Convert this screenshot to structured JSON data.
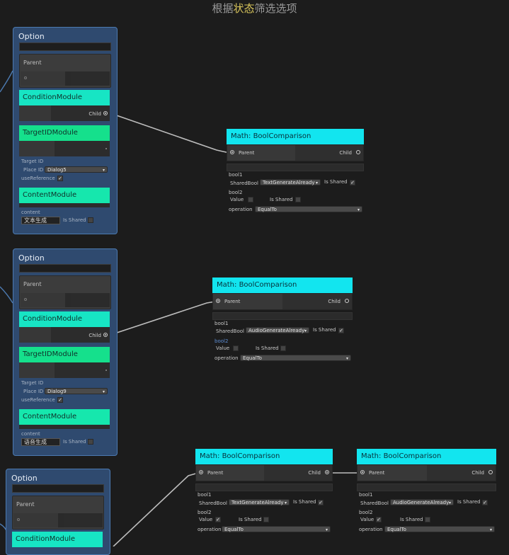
{
  "header": {
    "title_prefix": "根据",
    "title_highlight": "状态",
    "title_suffix": "筛选选项"
  },
  "options": [
    {
      "title": "Option",
      "parent_label": "Parent",
      "condition_label": "ConditionModule",
      "child_label": "Child",
      "target_label": "TargetIDModule",
      "target_id_label": "Target ID",
      "place_id_label": "Place ID",
      "place_id_value": "Dialog5",
      "use_reference_label": "useReference",
      "content_label": "ContentModule",
      "content_field_label": "content",
      "content_value": "文本生成",
      "is_shared_label": "Is Shared"
    },
    {
      "title": "Option",
      "parent_label": "Parent",
      "condition_label": "ConditionModule",
      "child_label": "Child",
      "target_label": "TargetIDModule",
      "target_id_label": "Target ID",
      "place_id_label": "Place ID",
      "place_id_value": "Dialog9",
      "use_reference_label": "useReference",
      "content_label": "ContentModule",
      "content_field_label": "content",
      "content_value": "语音生成",
      "is_shared_label": "Is Shared"
    },
    {
      "title": "Option",
      "parent_label": "Parent",
      "condition_label": "ConditionModule"
    }
  ],
  "bool_nodes": [
    {
      "title": "Math: BoolComparison",
      "parent_label": "Parent",
      "child_label": "Child",
      "bool1_label": "bool1",
      "shared_bool_label": "SharedBool",
      "shared_bool_value": "TextGenerateAlready",
      "is_shared_label": "Is Shared",
      "bool2_label": "bool2",
      "value_label": "Value",
      "operation_label": "operation",
      "operation_value": "EqualTo"
    },
    {
      "title": "Math: BoolComparison",
      "parent_label": "Parent",
      "child_label": "Child",
      "bool1_label": "bool1",
      "shared_bool_label": "SharedBool",
      "shared_bool_value": "AudioGenerateAlready",
      "is_shared_label": "Is Shared",
      "bool2_label": "bool2",
      "value_label": "Value",
      "operation_label": "operation",
      "operation_value": "EqualTo"
    },
    {
      "title": "Math: BoolComparison",
      "parent_label": "Parent",
      "child_label": "Child",
      "bool1_label": "bool1",
      "shared_bool_label": "SharedBool",
      "shared_bool_value": "TextGenerateAlready",
      "is_shared_label": "Is Shared",
      "bool2_label": "bool2",
      "value_label": "Value",
      "operation_label": "operation",
      "operation_value": "EqualTo"
    },
    {
      "title": "Math: BoolComparison",
      "parent_label": "Parent",
      "child_label": "Child",
      "bool1_label": "bool1",
      "shared_bool_label": "SharedBool",
      "shared_bool_value": "AudioGenerateAlready",
      "is_shared_label": "Is Shared",
      "bool2_label": "bool2",
      "value_label": "Value",
      "operation_label": "operation",
      "operation_value": "EqualTo"
    }
  ],
  "check_mark": "✓",
  "dropdown_arrow": "▾",
  "colors": {
    "canvas": "#1c1c1c",
    "option_node": "#2f4a6f",
    "condition_module": "#17e5c4",
    "target_module": "#15e08c",
    "bool_node_header": "#12e5ef",
    "wire": "#bdbdbd"
  }
}
